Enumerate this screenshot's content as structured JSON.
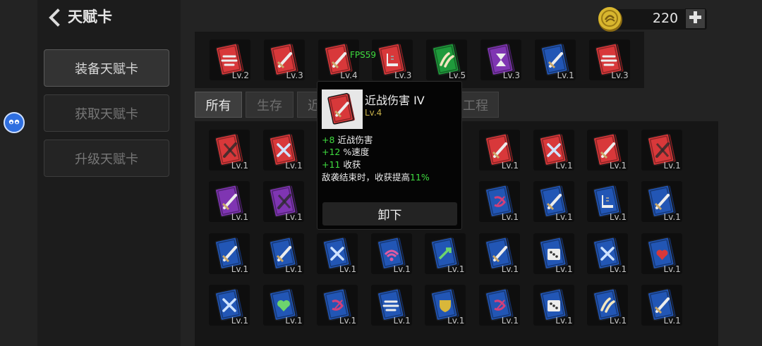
{
  "header": {
    "title": "天赋卡"
  },
  "sidebar": {
    "items": [
      {
        "label": "装备天赋卡",
        "active": true
      },
      {
        "label": "获取天赋卡",
        "active": false
      },
      {
        "label": "升级天赋卡",
        "active": false
      }
    ]
  },
  "currency": {
    "value": "220",
    "icon": "gold-coin-icon"
  },
  "equipped": [
    {
      "level": "Lv.2",
      "color": "red",
      "icon": "speed"
    },
    {
      "level": "Lv.3",
      "color": "red",
      "icon": "sword"
    },
    {
      "level": "Lv.4",
      "color": "red",
      "icon": "sword"
    },
    {
      "level": "Lv.3",
      "color": "red",
      "icon": "boot"
    },
    {
      "level": "Lv.5",
      "color": "green",
      "icon": "claws"
    },
    {
      "level": "Lv.3",
      "color": "purple",
      "icon": "hourglass"
    },
    {
      "level": "Lv.1",
      "color": "blue",
      "icon": "sword"
    },
    {
      "level": "Lv.3",
      "color": "red",
      "icon": "speed"
    }
  ],
  "overlay": {
    "fps": "FPS59"
  },
  "tabs": [
    {
      "label": "所有",
      "active": true
    },
    {
      "label": "生存",
      "active": false
    },
    {
      "label": "近",
      "active": false
    },
    {
      "label": "工程",
      "active": false
    }
  ],
  "grid": [
    [
      {
        "level": "Lv.1",
        "color": "red",
        "icon": "swords"
      },
      {
        "level": "Lv.1",
        "color": "red",
        "icon": "crossed"
      },
      null,
      null,
      null,
      {
        "level": "Lv.1",
        "color": "red",
        "icon": "sword"
      },
      {
        "level": "Lv.1",
        "color": "red",
        "icon": "crossed"
      },
      {
        "level": "Lv.1",
        "color": "red",
        "icon": "sword"
      },
      {
        "level": "Lv.1",
        "color": "red",
        "icon": "swords"
      }
    ],
    [
      {
        "level": "Lv.1",
        "color": "purple",
        "icon": "sword"
      },
      {
        "level": "Lv.1",
        "color": "purple",
        "icon": "swords"
      },
      null,
      null,
      null,
      {
        "level": "Lv.1",
        "color": "blue",
        "icon": "bow"
      },
      {
        "level": "Lv.1",
        "color": "blue",
        "icon": "sword"
      },
      {
        "level": "Lv.1",
        "color": "blue",
        "icon": "boot"
      },
      {
        "level": "Lv.1",
        "color": "blue",
        "icon": "sword"
      }
    ],
    [
      {
        "level": "Lv.1",
        "color": "blue",
        "icon": "sword"
      },
      {
        "level": "Lv.1",
        "color": "blue",
        "icon": "sword"
      },
      {
        "level": "Lv.1",
        "color": "blue",
        "icon": "crossed"
      },
      {
        "level": "Lv.1",
        "color": "blue",
        "icon": "wifi"
      },
      {
        "level": "Lv.1",
        "color": "blue",
        "icon": "arrow"
      },
      {
        "level": "Lv.1",
        "color": "blue",
        "icon": "sword"
      },
      {
        "level": "Lv.1",
        "color": "blue",
        "icon": "dice"
      },
      {
        "level": "Lv.1",
        "color": "blue",
        "icon": "crossed"
      },
      {
        "level": "Lv.1",
        "color": "blue",
        "icon": "hearts"
      }
    ],
    [
      {
        "level": "Lv.1",
        "color": "blue",
        "icon": "crossed"
      },
      {
        "level": "Lv.1",
        "color": "blue",
        "icon": "heart"
      },
      {
        "level": "Lv.1",
        "color": "blue",
        "icon": "bow"
      },
      {
        "level": "Lv.1",
        "color": "blue",
        "icon": "speed"
      },
      {
        "level": "Lv.1",
        "color": "blue",
        "icon": "shield"
      },
      {
        "level": "Lv.1",
        "color": "blue",
        "icon": "bow"
      },
      {
        "level": "Lv.1",
        "color": "blue",
        "icon": "dice"
      },
      {
        "level": "Lv.1",
        "color": "blue",
        "icon": "claws"
      },
      {
        "level": "Lv.1",
        "color": "blue",
        "icon": "sword"
      }
    ]
  ],
  "tooltip": {
    "name": "近战伤害 IV",
    "level": "Lv.4",
    "color": "red",
    "icon": "sword",
    "stats": [
      {
        "value": "+8",
        "label": " 近战伤害"
      },
      {
        "value": "+12",
        "label": " %速度"
      },
      {
        "value": "+11",
        "label": " 收获"
      }
    ],
    "effect": {
      "text": "敌袭结束时，收获提高",
      "value": "11%"
    },
    "button_label": "卸下"
  },
  "colors": {
    "red": "#d8383a",
    "blue": "#2256b5",
    "purple": "#7f35b2",
    "green": "#1f9a3b",
    "accent_green": "#3fdc3f",
    "level_gold": "#c9b24a",
    "coin": "#d8b62e"
  }
}
